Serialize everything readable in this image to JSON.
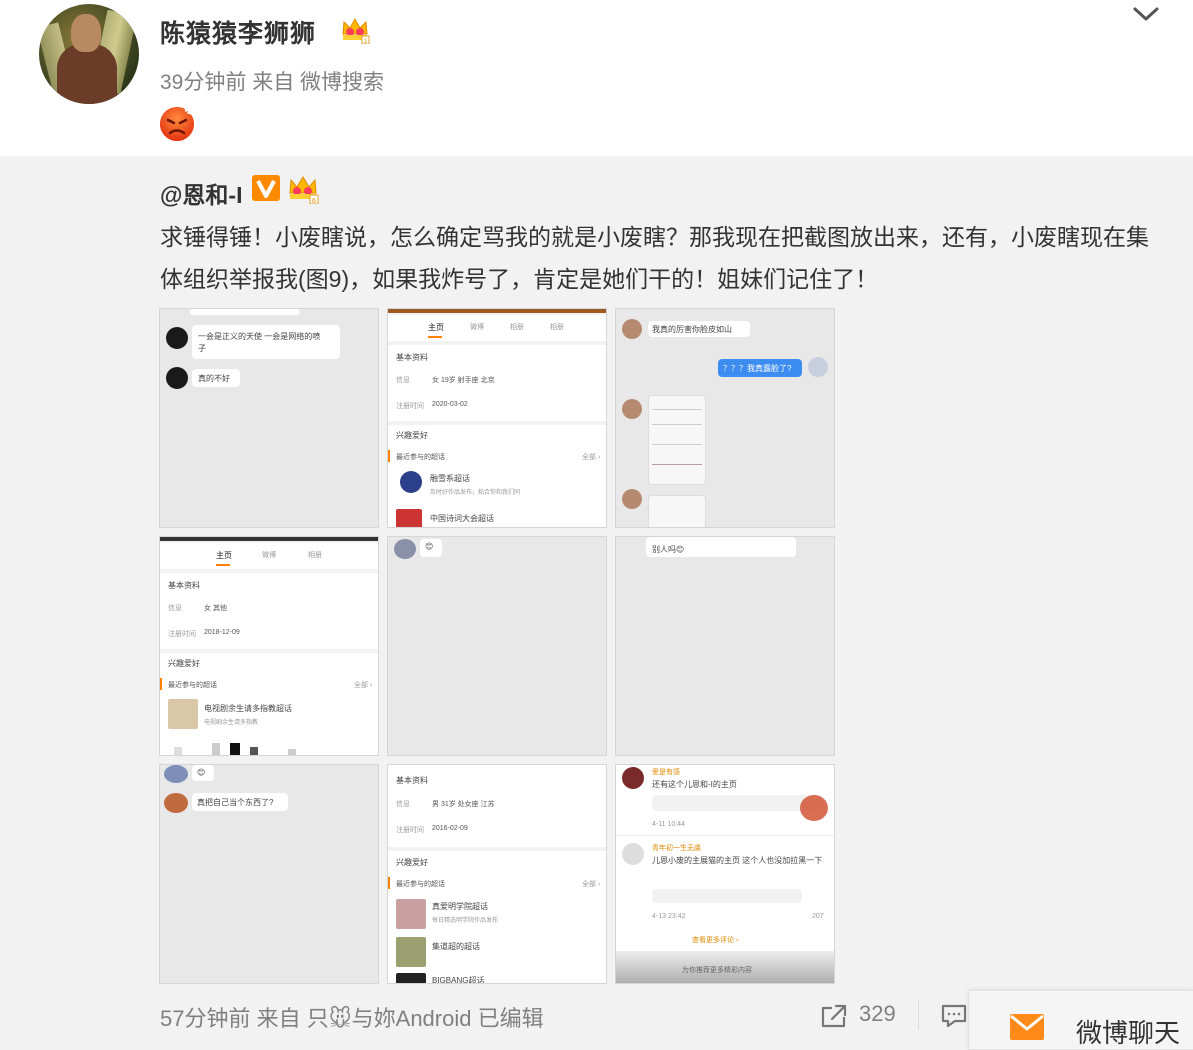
{
  "post": {
    "author": "陈猿猿李狮狮",
    "meta": "39分钟前 来自 微博搜索",
    "emoji": "angry-face"
  },
  "repost": {
    "author": "@恩和-I",
    "text": "求锤得锤！小废瞎说，怎么确定骂我的就是小废瞎？那我现在把截图放出来，还有，小废瞎现在集体组织举报我(图9)，如果我炸号了，肯定是她们干的！姐妹们记住了！",
    "images": [
      {
        "messages": [
          "一会是正义的天使 一会是网络的喷子",
          "真的不好"
        ]
      },
      {
        "tabs": [
          "主页",
          "微博",
          "相册",
          "相册"
        ],
        "section_basic": "基本资料",
        "info_label": "信息",
        "info_value": "女 19岁 射手座 北京",
        "reg_label": "注册时间",
        "reg_value": "2020-03-02",
        "section_interest": "兴趣爱好",
        "recent": "最近参与的超话",
        "more": "全部 ›",
        "topics": [
          "融雪系超话",
          "中国诗词大会超话"
        ],
        "topic_sub": "及时好作品发布，粘合你和我们同"
      },
      {
        "messages": [
          "我真的厉害你脸皮如山",
          "？？？我真露脸了?"
        ]
      },
      {
        "tabs": [
          "主页",
          "微博",
          "相册"
        ],
        "section_basic": "基本资料",
        "info_label": "信息",
        "info_value": "女 其他",
        "reg_label": "注册时间",
        "reg_value": "2018-12-09",
        "section_interest": "兴趣爱好",
        "recent": "最近参与的超话",
        "more": "全部 ›",
        "topics": [
          "电视剧余生请多指教超话"
        ],
        "topic_sub": "电视剧余生请多指教"
      },
      {
        "messages": [
          "😊"
        ]
      },
      {
        "messages": [
          "别人吗😊"
        ]
      },
      {
        "messages": [
          "😊",
          "真把自己当个东西了?"
        ]
      },
      {
        "section_basic": "基本资料",
        "info_label": "信息",
        "info_value": "男 31岁 处女座 江苏",
        "reg_label": "注册时间",
        "reg_value": "2016-02-09",
        "section_interest": "兴趣爱好",
        "recent": "最近参与的超话",
        "more": "全部 ›",
        "topics": [
          "真爱明学院超话",
          "集道超的超话",
          "BIGBANG超话"
        ],
        "topic_sub": "每日精选明学院作品发布"
      },
      {
        "comments": [
          "还有这个儿恩和-I的主页",
          "儿恩小废的主展猫的主页 这个人也没加拉黑一下"
        ],
        "names": [
          "爱是有感",
          "青年初一生无虞"
        ],
        "replies": [
          "查看更多回复 ›",
          "回复"
        ],
        "times": [
          "4-11 10:44",
          "4-13 23:42"
        ],
        "counts": [
          "207"
        ],
        "bottom": "查看更多评论 ›",
        "footer": "为你推荐更多精彩内容"
      }
    ]
  },
  "footer": {
    "meta": "57分钟前 来自 只🐭与妳Android  已编辑",
    "share_count": "329"
  },
  "chat": {
    "label": "微博聊天"
  },
  "colors": {
    "accent": "#ff8200",
    "text": "#333333",
    "meta": "#808080",
    "repost_bg": "#f2f2f2"
  }
}
